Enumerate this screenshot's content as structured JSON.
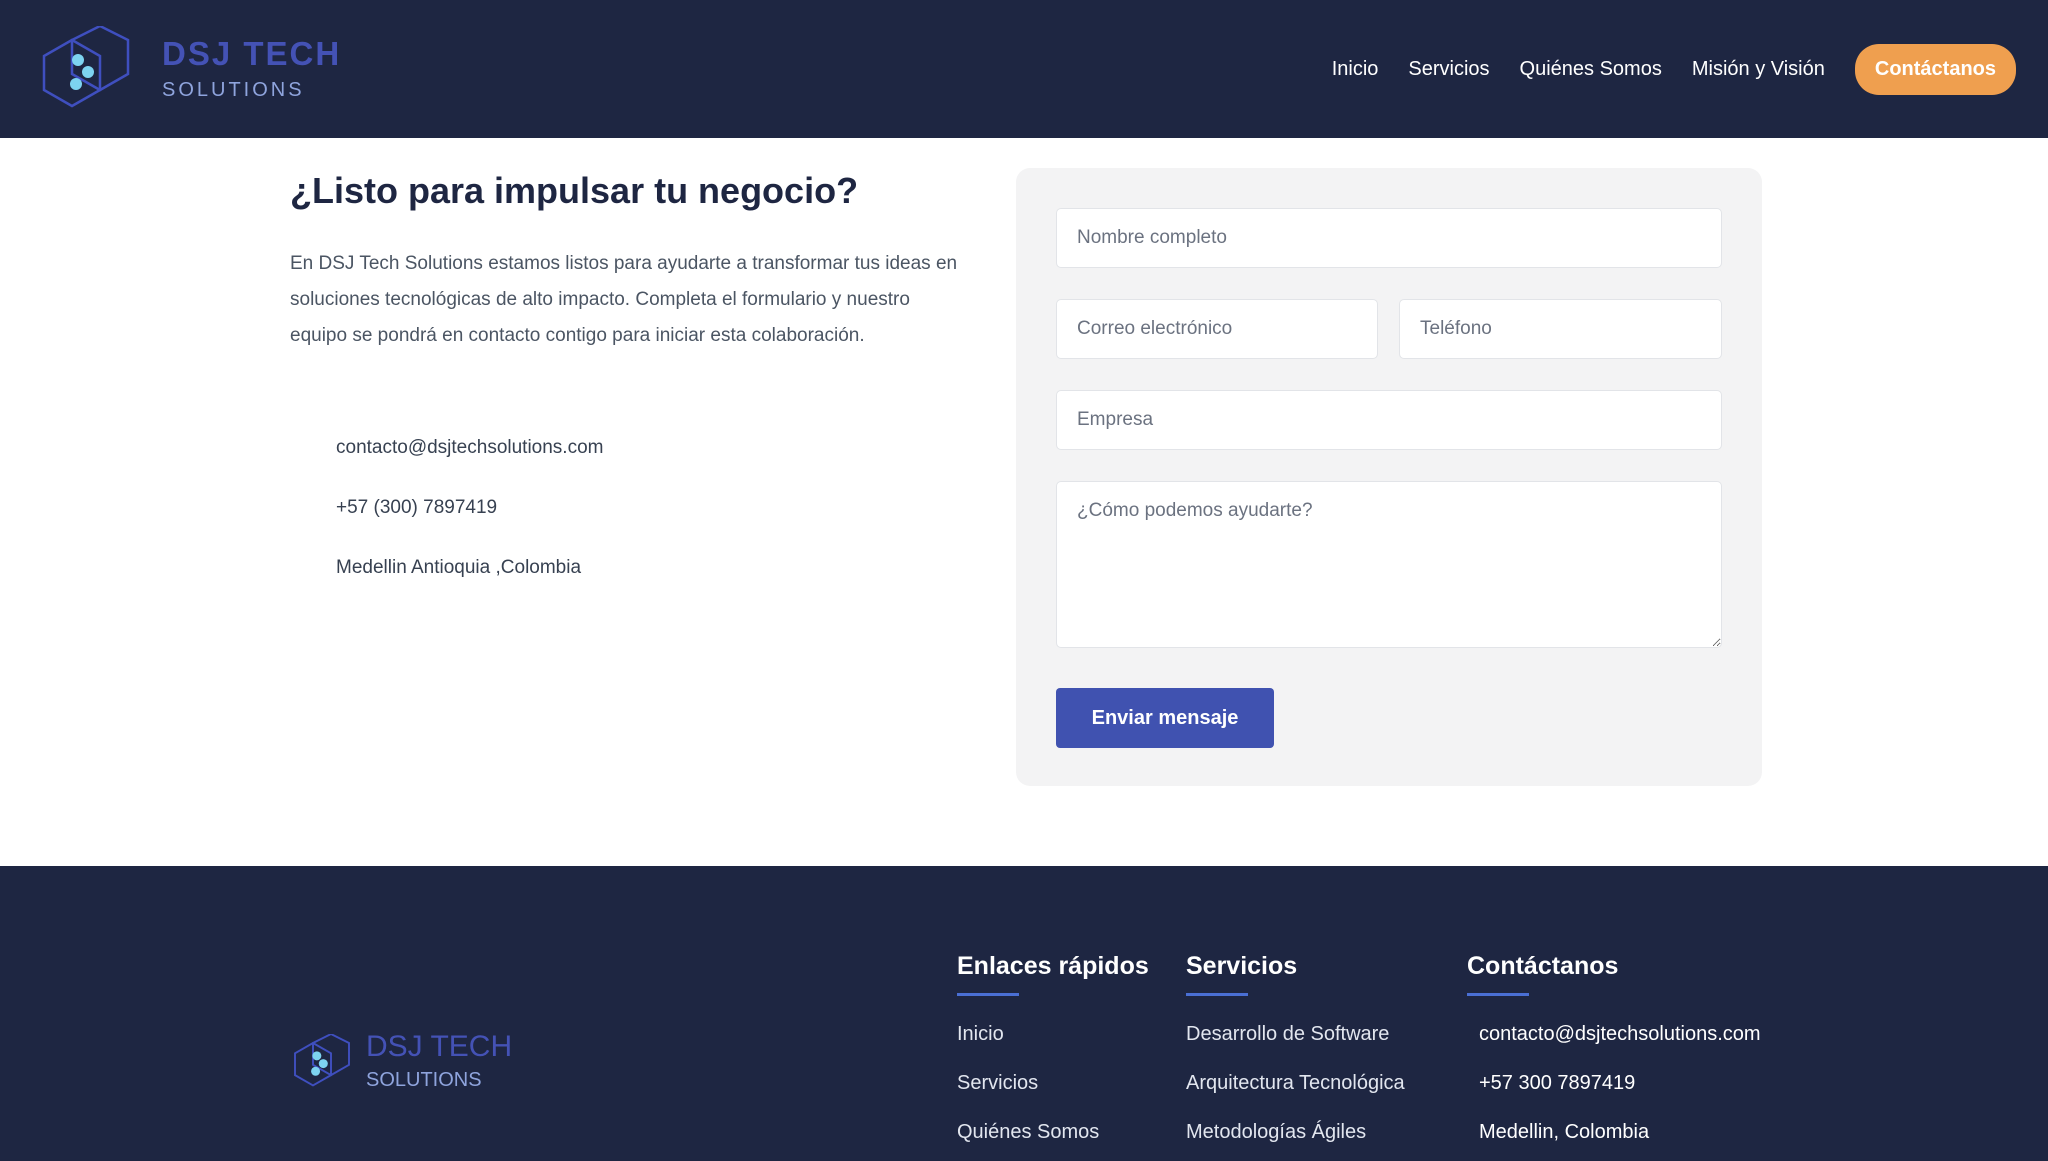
{
  "header": {
    "logo": {
      "title": "DSJ TECH",
      "subtitle": "SOLUTIONS",
      "icon": "hexagon-molecule-logo-icon"
    },
    "nav": {
      "items": [
        "Inicio",
        "Servicios",
        "Quiénes Somos",
        "Misión y Visión"
      ],
      "cta": "Contáctanos"
    }
  },
  "contact": {
    "title": "¿Listo para impulsar tu negocio?",
    "description": "En DSJ Tech Solutions estamos listos para ayudarte a transformar tus ideas en soluciones tecnológicas de alto impacto. Completa el formulario y nuestro equipo se pondrá en contacto contigo para iniciar esta colaboración.",
    "email": "contacto@dsjtechsolutions.com",
    "phone": "+57 (300) 7897419",
    "location": "Medellin Antioquia ,Colombia"
  },
  "form": {
    "name_placeholder": "Nombre completo",
    "email_placeholder": "Correo electrónico",
    "phone_placeholder": "Teléfono",
    "company_placeholder": "Empresa",
    "message_placeholder": "¿Cómo podemos ayudarte?",
    "submit_label": "Enviar mensaje"
  },
  "footer": {
    "logo": {
      "title": "DSJ TECH",
      "subtitle": "SOLUTIONS"
    },
    "quick_links": {
      "title": "Enlaces rápidos",
      "items": [
        "Inicio",
        "Servicios",
        "Quiénes Somos"
      ]
    },
    "services": {
      "title": "Servicios",
      "items": [
        "Desarrollo de Software",
        "Arquitectura Tecnológica",
        "Metodologías Ágiles"
      ]
    },
    "contact": {
      "title": "Contáctanos",
      "email": "contacto@dsjtechsolutions.com",
      "phone": "+57 300 7897419",
      "location": "Medellin, Colombia"
    }
  },
  "colors": {
    "navy": "#1e2642",
    "brand_blue": "#4452b5",
    "light_blue": "#8fa4dd",
    "accent_orange": "#ef9f4f",
    "button_blue": "#4052b0",
    "form_bg": "#f3f3f4"
  }
}
